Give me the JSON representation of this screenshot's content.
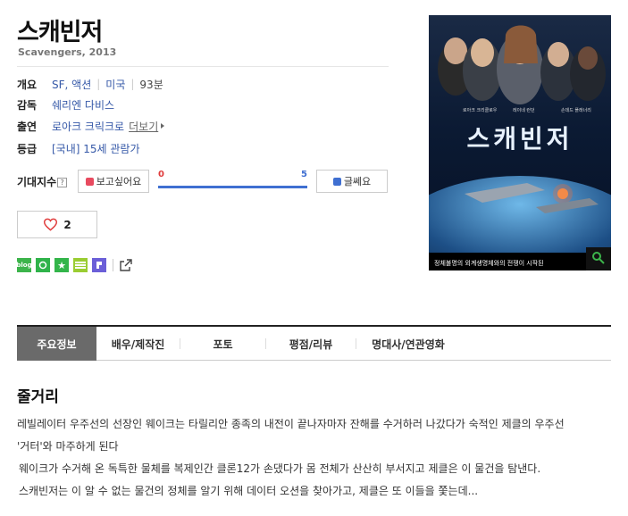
{
  "movie": {
    "title": "스캐빈저",
    "subtitle": "Scavengers, 2013"
  },
  "info": {
    "overview": {
      "label": "개요",
      "genre": "SF, 액션",
      "country": "미국",
      "runtime": "93분"
    },
    "director": {
      "label": "감독",
      "name": "쉐리엔 다비스"
    },
    "cast": {
      "label": "출연",
      "names": "로아크 크릭크로",
      "more": "더보기"
    },
    "rating": {
      "label": "등급",
      "value": "[국내] 15세 관람가"
    }
  },
  "expectation": {
    "label": "기대지수",
    "help": "?",
    "want_button": "보고싶어요",
    "meh_button": "글쎄요",
    "min": "0",
    "max": "5"
  },
  "like": {
    "count": "2"
  },
  "share": {
    "icons": [
      {
        "name": "blog-icon",
        "text": "blog",
        "color": "#3cb44b"
      },
      {
        "name": "cafe-icon",
        "text": "",
        "color": "#2fb34a"
      },
      {
        "name": "star-icon",
        "text": "★",
        "color": "#33b54a"
      },
      {
        "name": "memo-icon",
        "text": "",
        "color": "#9acd32"
      },
      {
        "name": "band-icon",
        "text": "",
        "color": "#6b5fd8"
      }
    ]
  },
  "poster": {
    "actors": [
      "로아크 크리클로우",
      "레이네 런던",
      "손데드 플래너리"
    ],
    "title": "스캐빈저",
    "tagline": "정체불명의 외계생명체와의 전쟁이 시작된"
  },
  "tabs": [
    "주요정보",
    "배우/제작진",
    "포토",
    "평점/리뷰",
    "명대사/연관영화"
  ],
  "synopsis": {
    "heading": "줄거리",
    "lines": [
      "레빌레이터 우주선의 선장인 웨이크는 타릴리안 종족의 내전이 끝나자마자 잔해를 수거하러 나갔다가 숙적인 제클의 우주선",
      "'거터'와 마주하게 된다",
      "웨이크가 수거해 온 독특한 물체를 복제인간 클론12가 손댔다가 몸 전체가 산산히 부서지고 제클은 이 물건을 탐낸다.",
      "스캐빈저는 이 알 수 없는 물건의 정체를 알기 위해 데이터 오션을 찾아가고, 제클은 또 이들을 쫓는데..."
    ]
  }
}
